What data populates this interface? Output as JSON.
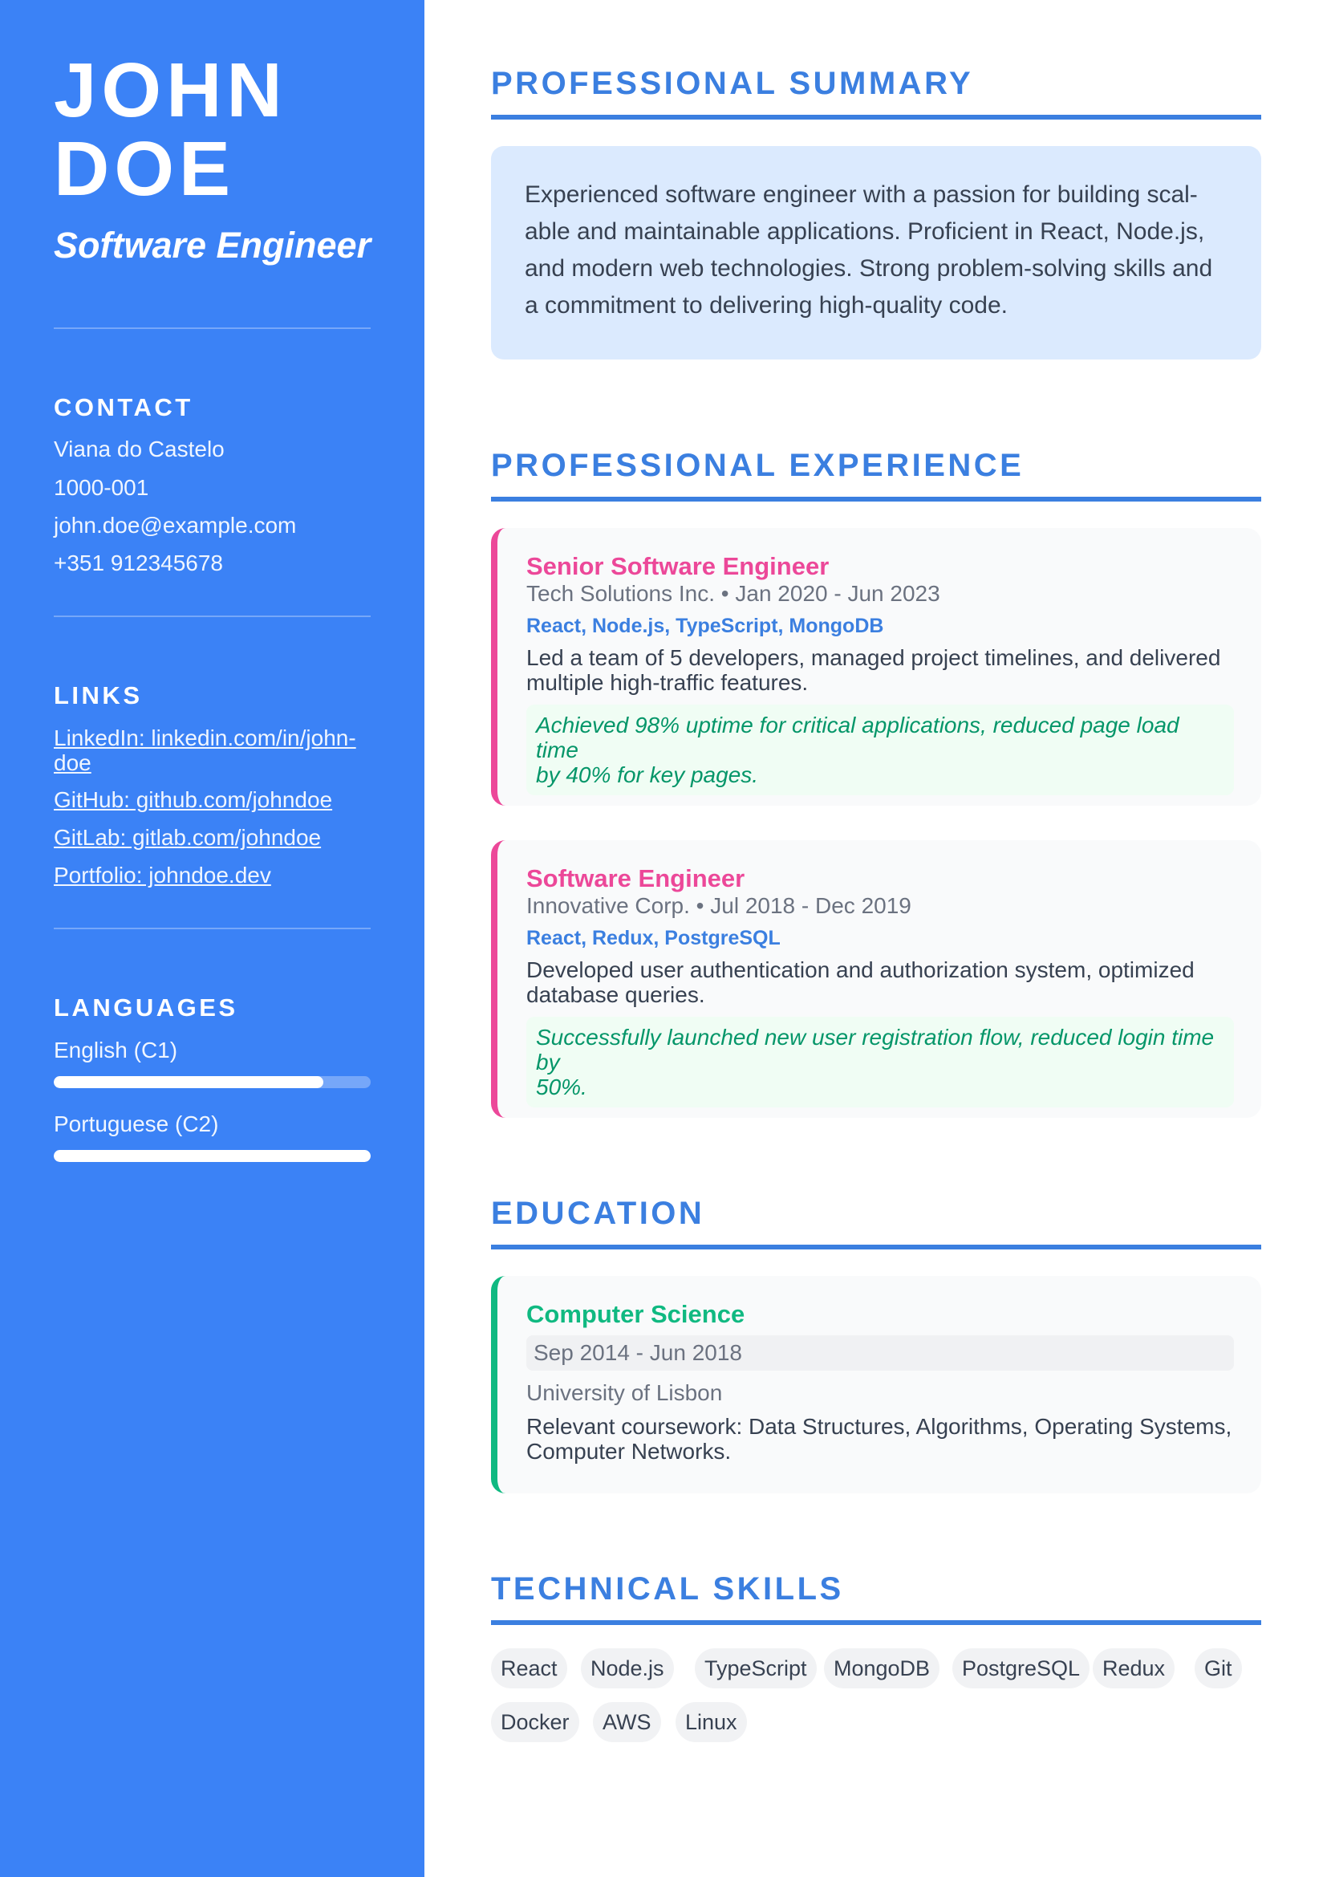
{
  "profile": {
    "first_name": "JOHN",
    "last_name": "DOE",
    "role": "Software Engineer"
  },
  "contact": {
    "heading": "CONTACT",
    "location": "Viana do Castelo",
    "postal": "1000-001",
    "email": "john.doe@example.com",
    "phone": "+351 912345678"
  },
  "links": {
    "heading": "LINKS",
    "items": [
      {
        "label_line1": "LinkedIn: linkedin.com/in/john-",
        "label_line2": "doe"
      },
      {
        "label": "GitHub: github.com/johndoe"
      },
      {
        "label": "GitLab: gitlab.com/johndoe"
      },
      {
        "label": "Portfolio: johndoe.dev"
      }
    ]
  },
  "languages": {
    "heading": "LANGUAGES",
    "items": [
      {
        "label": "English (C1)",
        "level": 0.85
      },
      {
        "label": "Portuguese (C2)",
        "level": 1.0
      }
    ]
  },
  "summary": {
    "heading": "PROFESSIONAL SUMMARY",
    "lines": [
      "Experienced software engineer with a passion for building scal-",
      "able and maintainable applications. Proficient in React, Node.js,",
      "and modern web technologies. Strong problem-solving skills and",
      "a commitment to delivering high-quality code."
    ]
  },
  "experience": {
    "heading": "PROFESSIONAL EXPERIENCE",
    "items": [
      {
        "title": "Senior Software Engineer",
        "meta": "Tech Solutions Inc. • Jan 2020 - Jun 2023",
        "tech": "React, Node.js, TypeScript, MongoDB",
        "desc_line1": "Led a team of 5 developers, managed project timelines, and delivered",
        "desc_line2": "multiple high-traffic features.",
        "achieve_line1": "Achieved 98% uptime for critical applications, reduced page load time",
        "achieve_line2": "by 40% for key pages."
      },
      {
        "title": "Software Engineer",
        "meta": "Innovative Corp. • Jul 2018 - Dec 2019",
        "tech": "React, Redux, PostgreSQL",
        "desc_line1": "Developed user authentication and authorization system, optimized",
        "desc_line2": "database queries.",
        "achieve_line1": "Successfully launched new user registration flow, reduced login time by",
        "achieve_line2": "50%."
      }
    ]
  },
  "education": {
    "heading": "EDUCATION",
    "items": [
      {
        "title": "Computer Science",
        "dates": "Sep 2014 - Jun 2018",
        "school": "University of Lisbon",
        "desc_line1": "Relevant coursework: Data Structures, Algorithms, Operating Systems,",
        "desc_line2": "Computer Networks."
      }
    ]
  },
  "skills": {
    "heading": "TECHNICAL SKILLS",
    "items": [
      "React",
      "Node.js",
      "TypeScript",
      "MongoDB",
      "PostgreSQL",
      "Redux",
      "Git",
      "Docker",
      "AWS",
      "Linux"
    ]
  }
}
